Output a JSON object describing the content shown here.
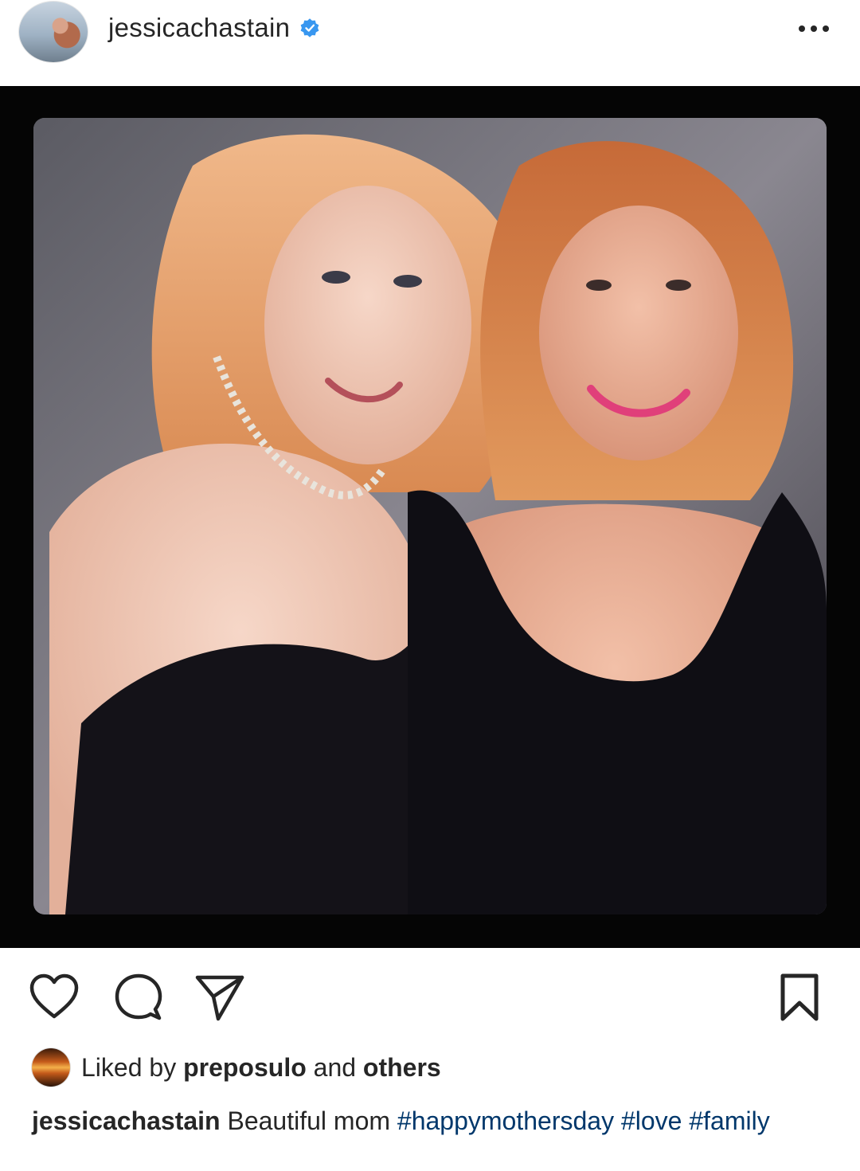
{
  "header": {
    "username": "jessicachastain",
    "verified": true,
    "verified_color": "#3897f0",
    "more_icon": "more-horizontal-icon"
  },
  "post": {
    "image_description": "",
    "frame_color": "#050505"
  },
  "actions": {
    "like_icon": "heart-icon",
    "comment_icon": "comment-icon",
    "share_icon": "send-icon",
    "save_icon": "bookmark-icon"
  },
  "likes": {
    "prefix": "Liked by",
    "user": "preposulo",
    "conjunction": "and",
    "others": "others"
  },
  "caption": {
    "username": "jessicachastain",
    "text": "Beautiful mom",
    "hashtags": [
      "#happymothersday",
      "#love",
      "#family"
    ],
    "hashtag_color": "#00376b"
  }
}
